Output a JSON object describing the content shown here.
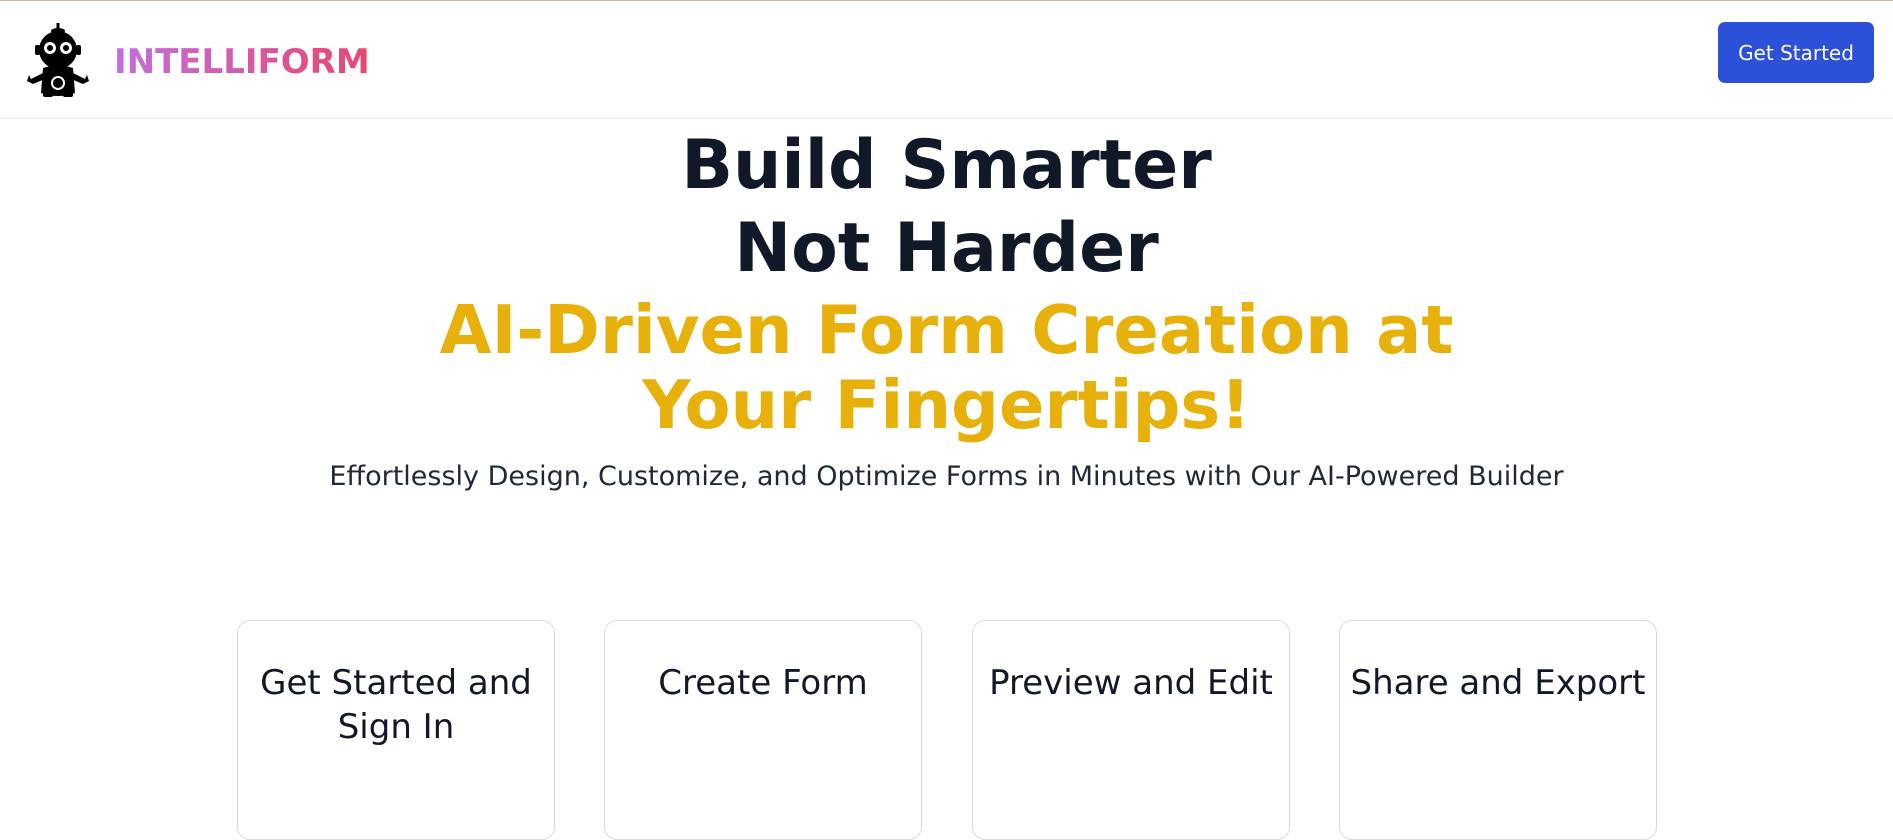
{
  "navbar": {
    "brand": "INTELLIFORM",
    "logo_icon": "robot-mascot-icon",
    "get_started_label": "Get Started"
  },
  "hero": {
    "title_line1": "Build Smarter",
    "title_line2": "Not Harder",
    "highlight": "AI-Driven Form Creation at Your Fingertips!",
    "subtitle": "Effortlessly Design, Customize, and Optimize Forms in Minutes with Our AI-Powered Builder"
  },
  "steps": [
    {
      "title": "Get Started and Sign In"
    },
    {
      "title": "Create Form"
    },
    {
      "title": "Preview and Edit"
    },
    {
      "title": "Share and Export"
    }
  ],
  "colors": {
    "primary_button": "#2d50d8",
    "heading": "#111827",
    "highlight": "#e8b00b",
    "brand_gradient_start": "#c26ee0",
    "brand_gradient_end": "#e8476e"
  }
}
